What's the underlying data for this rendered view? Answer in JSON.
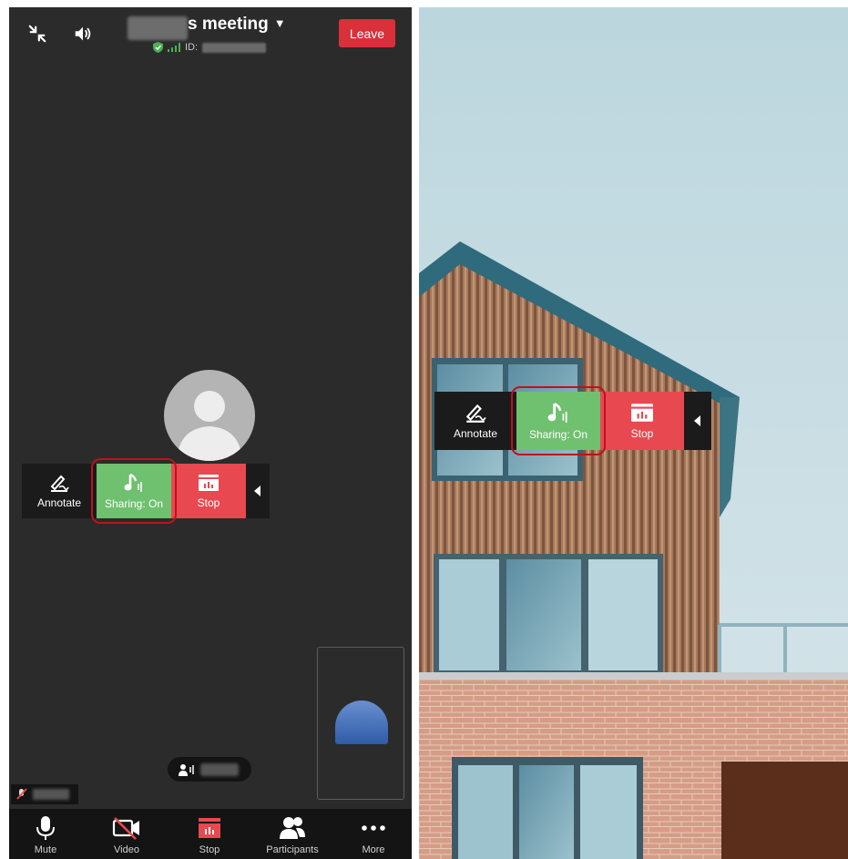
{
  "left_panel": {
    "meeting_title": "s meeting",
    "id_prefix": "ID:",
    "leave_label": "Leave",
    "share_toolbar": {
      "annotate_label": "Annotate",
      "sharing_label": "Sharing: On",
      "stop_label": "Stop"
    },
    "bottom_bar": {
      "mute_label": "Mute",
      "video_label": "Video",
      "stop_label": "Stop",
      "participants_label": "Participants",
      "more_label": "More"
    }
  },
  "right_panel": {
    "share_toolbar": {
      "annotate_label": "Annotate",
      "sharing_label": "Sharing: On",
      "stop_label": "Stop"
    }
  },
  "colors": {
    "leave": "#d9303a",
    "sharing_active": "#6fc06f",
    "stop": "#e8484f",
    "highlight": "#c01020",
    "encryption": "#4caf50"
  },
  "icons": [
    "minimize-icon",
    "speaker-icon",
    "shield-icon",
    "signal-icon",
    "caret-down-icon",
    "annotate-icon",
    "music-note-icon",
    "stop-share-icon",
    "collapse-arrow-icon",
    "microphone-icon",
    "video-off-icon",
    "participants-icon",
    "more-icon",
    "avatar-icon"
  ]
}
